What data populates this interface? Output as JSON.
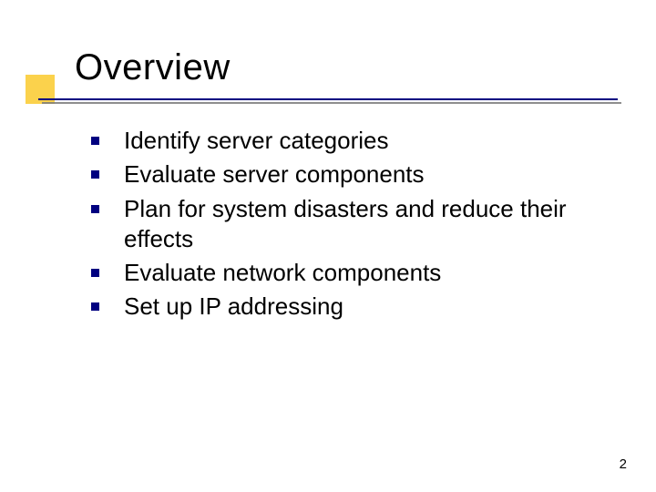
{
  "title": "Overview",
  "bullets": [
    "Identify server categories",
    "Evaluate server components",
    "Plan for system disasters and reduce their effects",
    "Evaluate network components",
    "Set up IP addressing"
  ],
  "page_number": "2",
  "colors": {
    "accent": "#fbd24c",
    "rule": "#000080",
    "bullet": "#000080"
  }
}
